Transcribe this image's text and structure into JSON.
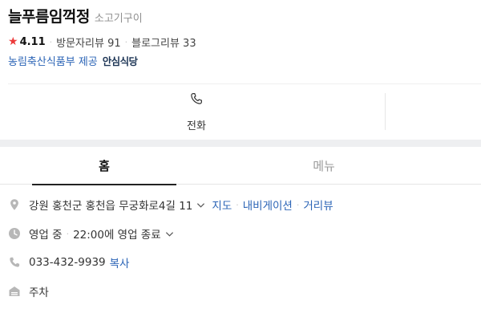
{
  "place": {
    "name": "늘푸름임꺽정",
    "category": "소고기구이",
    "rating": "4.11",
    "visitor_reviews": "방문자리뷰 91",
    "blog_reviews": "블로그리뷰 33",
    "provider": "농림축산식품부 제공",
    "badge": "안심식당"
  },
  "actions": {
    "call_label": "전화"
  },
  "tabs": [
    {
      "label": "홈",
      "active": true
    },
    {
      "label": "메뉴",
      "active": false
    }
  ],
  "info": {
    "address": "강원 홍천군 홍천읍 무궁화로4길 11",
    "map_link": "지도",
    "navigation_link": "내비게이션",
    "street_view_link": "거리뷰",
    "status": "영업 중",
    "hours": "22:00에 영업 종료",
    "phone": "033-432-9939",
    "copy_link": "복사",
    "parking": "주차"
  },
  "colors": {
    "link": "#2b64b6",
    "star": "#ec3a3a",
    "icon": "#b7b7b7"
  },
  "icons": [
    "star-icon",
    "phone-icon",
    "location-pin-icon",
    "clock-icon",
    "parking-icon",
    "chevron-down-icon"
  ]
}
